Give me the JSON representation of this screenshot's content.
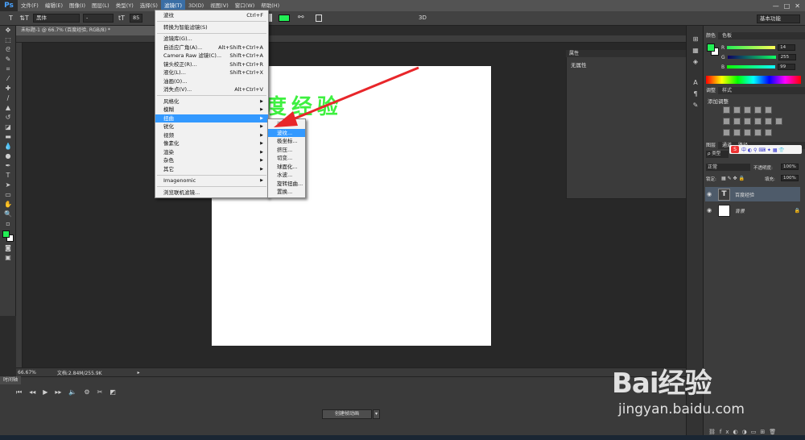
{
  "app": {
    "logo": "Ps"
  },
  "menubar": {
    "items": [
      "文件(F)",
      "编辑(E)",
      "图像(I)",
      "图层(L)",
      "类型(Y)",
      "选择(S)",
      "滤镜(T)",
      "3D(D)",
      "视图(V)",
      "窗口(W)",
      "帮助(H)"
    ],
    "active_index": 6,
    "win_min": "—",
    "win_max": "□",
    "win_close": "✕"
  },
  "options_bar": {
    "tool_icon": "T",
    "orient_icon": "⇅T",
    "font_family": "黑体",
    "font_style": "-",
    "size_icon": "tT",
    "size_value": "85",
    "mode_3d": "3D",
    "text_color": "#22ee55",
    "workspace": "基本功能"
  },
  "document": {
    "tab_title": "未标题-1 @ 66.7% (百度经验, RGB/8) *",
    "canvas_text": "度经验",
    "canvas_text_color": "#3ef040"
  },
  "filter_menu": {
    "items": [
      {
        "label": "波纹",
        "shortcut": "Ctrl+F"
      },
      {
        "sep": true
      },
      {
        "label": "转换为智能滤镜(S)",
        "shortcut": ""
      },
      {
        "sep": true
      },
      {
        "label": "滤镜库(G)...",
        "shortcut": ""
      },
      {
        "label": "自适应广角(A)...",
        "shortcut": "Alt+Shift+Ctrl+A"
      },
      {
        "label": "Camera Raw 滤镜(C)...",
        "shortcut": "Shift+Ctrl+A"
      },
      {
        "label": "镜头校正(R)...",
        "shortcut": "Shift+Ctrl+R"
      },
      {
        "label": "液化(L)...",
        "shortcut": "Shift+Ctrl+X"
      },
      {
        "label": "油画(O)...",
        "shortcut": ""
      },
      {
        "label": "消失点(V)...",
        "shortcut": "Alt+Ctrl+V"
      },
      {
        "sep": true
      },
      {
        "label": "风格化",
        "submenu": true
      },
      {
        "label": "模糊",
        "submenu": true
      },
      {
        "label": "扭曲",
        "submenu": true,
        "highlight": true
      },
      {
        "label": "锐化",
        "submenu": true
      },
      {
        "label": "视频",
        "submenu": true
      },
      {
        "label": "像素化",
        "submenu": true
      },
      {
        "label": "渲染",
        "submenu": true
      },
      {
        "label": "杂色",
        "submenu": true
      },
      {
        "label": "其它",
        "submenu": true
      },
      {
        "sep": true
      },
      {
        "label": "Imagenomic",
        "submenu": true
      },
      {
        "sep": true
      },
      {
        "label": "浏览联机滤镜...",
        "shortcut": ""
      }
    ]
  },
  "distort_submenu": {
    "items": [
      {
        "label": "波浪...",
        "highlight": false
      },
      {
        "label": "波纹...",
        "highlight": true
      },
      {
        "label": "极坐标..."
      },
      {
        "label": "挤压..."
      },
      {
        "label": "切变..."
      },
      {
        "label": "球面化..."
      },
      {
        "label": "水波..."
      },
      {
        "label": "旋转扭曲..."
      },
      {
        "label": "置换..."
      }
    ]
  },
  "properties_panel": {
    "title": "属性",
    "body": "无属性"
  },
  "status": {
    "zoom": "66.67%",
    "doc_size": "文档:2.84M/255.9K"
  },
  "timeline": {
    "tab": "时间轴",
    "create_button": "创建帧动画",
    "dropdown": "▾"
  },
  "color_panel": {
    "tabs": [
      "颜色",
      "色板"
    ],
    "r_label": "R",
    "r_value": "14",
    "g_label": "G",
    "g_value": "255",
    "b_label": "B",
    "b_value": "99",
    "fg_color": "#22ee55"
  },
  "adjust_panel": {
    "tabs": [
      "调整",
      "样式"
    ],
    "title": "添加调整"
  },
  "layers_panel": {
    "tabs": [
      "图层",
      "通道",
      "路径"
    ],
    "kind_label": "ρ 类型",
    "blend_mode": "正常",
    "opacity_label": "不透明度:",
    "opacity_value": "100%",
    "lock_label": "锁定:",
    "fill_label": "填充:",
    "fill_value": "100%",
    "layers": [
      {
        "name": "百度经验",
        "type": "T",
        "selected": true
      },
      {
        "name": "背景",
        "type": "",
        "selected": false,
        "locked": "🔒"
      }
    ]
  },
  "watermark": {
    "logo": "Bai经验",
    "url": "jingyan.baidu.com"
  }
}
